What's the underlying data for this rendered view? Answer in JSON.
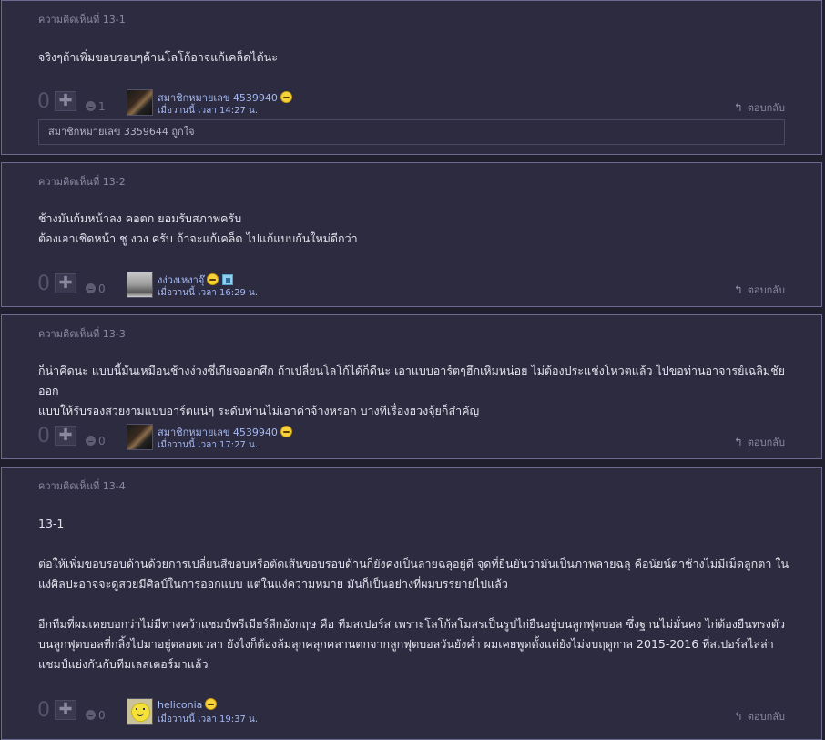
{
  "comments": [
    {
      "title": "ความคิดเห็นที่ 13-1",
      "body": [
        "จริงๆถ้าเพิ่มขอบรอบๆด้านโลโก้อาจแก้เคล็ดได้นะ"
      ],
      "votes": "0",
      "emotion_count": "1",
      "user": "สมาชิกหมายเลข 4539940",
      "date": "เมื่อวานนี้ เวลา 14:27 น.",
      "reply_label": "ตอบกลับ",
      "nested_like": "สมาชิกหมายเลข 3359644 ถูกใจ"
    },
    {
      "title": "ความคิดเห็นที่ 13-2",
      "body": [
        "ช้างมันก้มหน้าลง คอตก ยอมรับสภาพครับ",
        "ต้องเอาเชิดหน้า ชู งวง ครับ ถ้าจะแก้เคล็ด ไปแก้แบบกันใหม่ดีกว่า"
      ],
      "votes": "0",
      "emotion_count": "0",
      "user": "งง่วงเหงาจุ๊",
      "date": "เมื่อวานนี้ เวลา 16:29 น.",
      "reply_label": "ตอบกลับ"
    },
    {
      "title": "ความคิดเห็นที่ 13-3",
      "body": [
        "ก็น่าคิดนะ แบบนี้มันเหมือนช้างง่วงซึ่เกียจออกศึก ถ้าเปลี่ยนโลโก้ได้ก็ดีนะ เอาแบบอาร์ตๆฮึกเหิมหน่อย ไม่ต้องประแช่งโหวตแล้ว ไปขอท่านอาจารย์เฉลิมชัยออก",
        "แบบให้รับรองสวยงามแบบอาร์ตแน่ๆ ระดับท่านไม่เอาค่าจ้างหรอก บางทีเรื่องฮวงจุ้ยก็สำคัญ"
      ],
      "votes": "0",
      "emotion_count": "0",
      "user": "สมาชิกหมายเลข 4539940",
      "date": "เมื่อวานนี้ เวลา 17:27 น.",
      "reply_label": "ตอบกลับ"
    },
    {
      "title": "ความคิดเห็นที่ 13-4",
      "body": [
        "13-1",
        "",
        "ต่อให้เพิ่มขอบรอบด้านด้วยการเปลี่ยนสีขอบหรือตัดเส้นขอบรอบด้านก็ยังคงเป็นลายฉลุอยู่ดี จุดที่ยืนยันว่ามันเป็นภาพลายฉลุ คือนัยน์ตาช้างไม่มีเม็ดลูกตา ใน",
        "แง่ศิลปะอาจจะดูสวยมีศิลป์ในการออกแบบ แต่ในแง่ความหมาย มันก็เป็นอย่างที่ผมบรรยายไปแล้ว",
        "",
        "อีกทีมที่ผมเคยบอกว่าไม่มีทางคว้าแชมป์พรีเมียร์ลีกอังกฤษ คือ ทีมสเปอร์ส เพราะโลโก้สโมสรเป็นรูปไก่ยืนอยู่บนลูกฟุตบอล ซึ่งฐานไม่มั่นคง ไก่ต้องยืนทรงตัว",
        "บนลูกฟุตบอลที่กลิ้งไปมาอยู่ตลอดเวลา ยังไงก็ต้องล้มลุกคลุกคลานตกจากลูกฟุตบอลวันยังค่ำ ผมเคยพูดตั้งแต่ยังไม่จบฤดูกาล 2015-2016 ที่สเปอร์สไล่ล่า",
        "แชมป์แย่งกันกับทีมเลสเตอร์มาแล้ว"
      ],
      "votes": "0",
      "emotion_count": "0",
      "user": "heliconia",
      "date": "เมื่อวานนี้ เวลา 19:37 น.",
      "reply_label": "ตอบกลับ"
    }
  ]
}
